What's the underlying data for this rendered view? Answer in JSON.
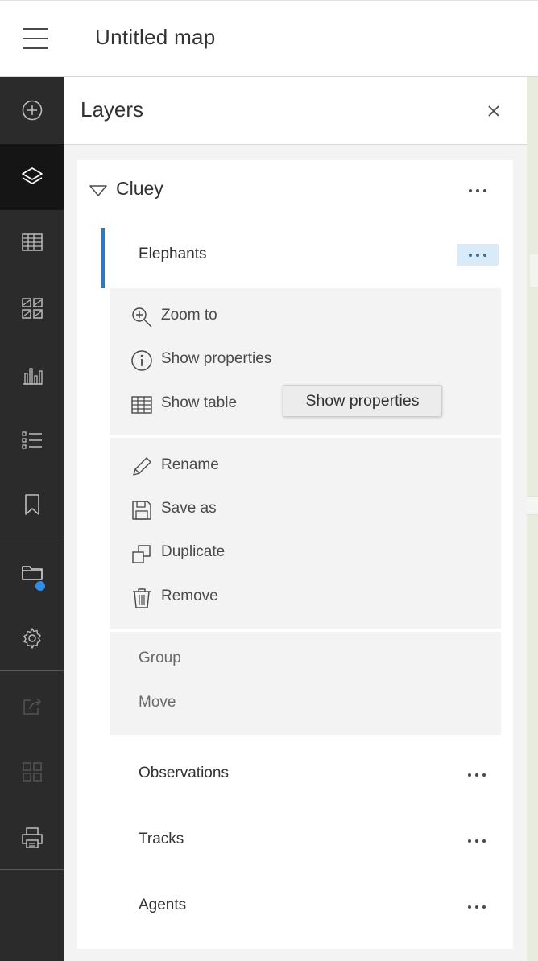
{
  "header": {
    "title": "Untitled map"
  },
  "sidebar": {
    "buttons": [
      {
        "icon": "add-circle-icon"
      },
      {
        "icon": "layers-icon",
        "active": true
      },
      {
        "icon": "table-icon"
      },
      {
        "icon": "basemap-gallery-icon"
      },
      {
        "icon": "bar-chart-icon"
      },
      {
        "icon": "legend-list-icon"
      },
      {
        "icon": "bookmark-icon"
      },
      {
        "icon": "map-properties-icon",
        "badge": true
      },
      {
        "icon": "settings-gear-icon"
      },
      {
        "icon": "share-icon",
        "disabled": true
      },
      {
        "icon": "apps-grid-icon",
        "disabled": true
      },
      {
        "icon": "print-icon"
      }
    ],
    "badge_color": "#2f8fe8"
  },
  "panel": {
    "title": "Layers",
    "group": {
      "name": "Cluey"
    },
    "layers": [
      {
        "name": "Elephants",
        "selected": true
      },
      {
        "name": "Observations"
      },
      {
        "name": "Tracks"
      },
      {
        "name": "Agents"
      }
    ],
    "menu": {
      "section1": [
        {
          "label": "Zoom to",
          "icon": "zoom-in-icon"
        },
        {
          "label": "Show properties",
          "icon": "info-icon"
        },
        {
          "label": "Show table",
          "icon": "table-icon"
        }
      ],
      "section2": [
        {
          "label": "Rename",
          "icon": "pencil-icon"
        },
        {
          "label": "Save as",
          "icon": "save-icon"
        },
        {
          "label": "Duplicate",
          "icon": "duplicate-icon"
        },
        {
          "label": "Remove",
          "icon": "trash-icon"
        }
      ],
      "section3": [
        {
          "label": "Group"
        },
        {
          "label": "Move"
        }
      ]
    },
    "tooltip": "Show properties"
  },
  "colors": {
    "accent": "#2f7abf",
    "sidebar_bg": "#2b2b2b",
    "sidebar_active": "#151515",
    "menu_bg": "#f3f3f3"
  }
}
